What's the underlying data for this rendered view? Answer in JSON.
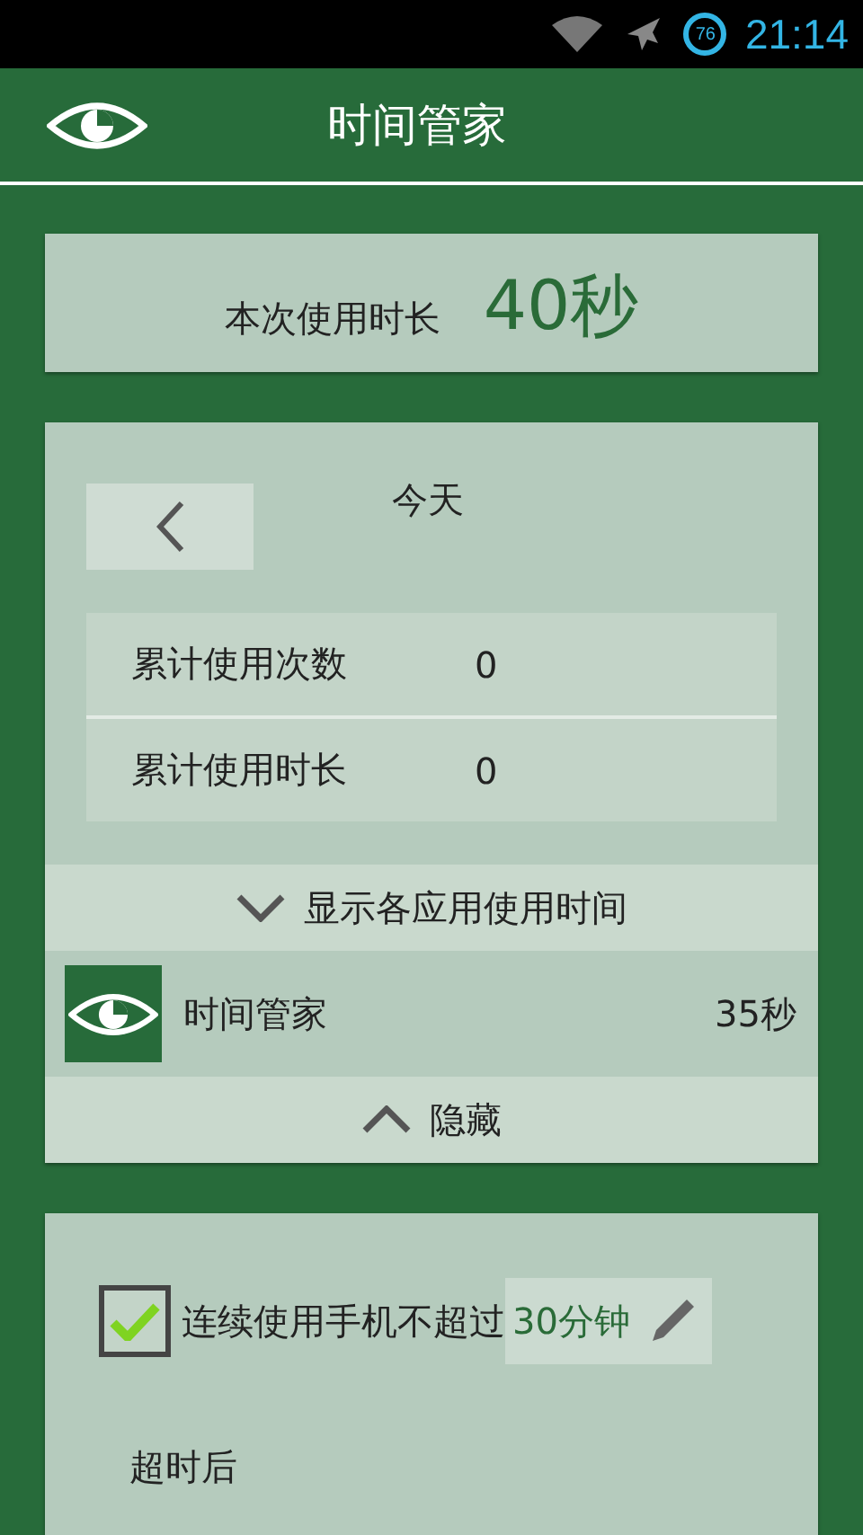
{
  "status_bar": {
    "battery": "76",
    "time": "21:14"
  },
  "app_bar": {
    "title": "时间管家"
  },
  "session": {
    "label": "本次使用时长",
    "value": "40秒"
  },
  "stats": {
    "day": "今天",
    "rows": [
      {
        "label": "累计使用次数",
        "value": "0"
      },
      {
        "label": "累计使用时长",
        "value": "0"
      }
    ],
    "expand_label": "显示各应用使用时间",
    "apps": [
      {
        "name": "时间管家",
        "time": "35秒"
      }
    ],
    "collapse_label": "隐藏"
  },
  "limit": {
    "checked": true,
    "label": "连续使用手机不超过",
    "value": "30分钟",
    "after_label": "超时后"
  }
}
